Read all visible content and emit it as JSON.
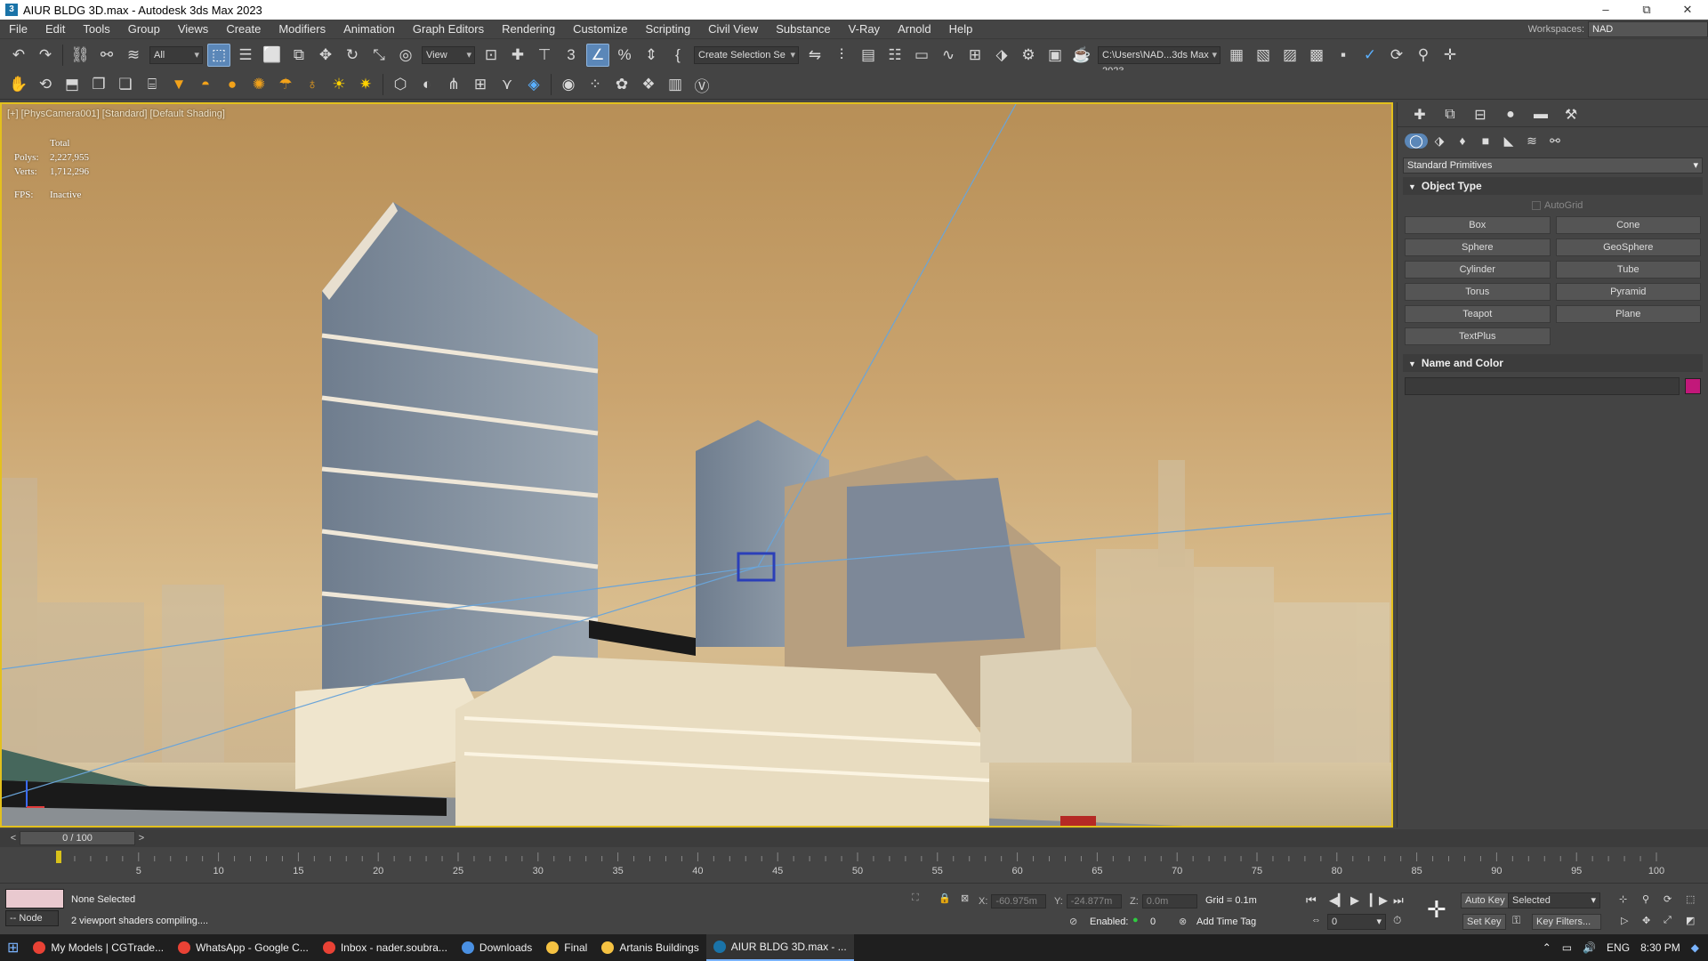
{
  "window": {
    "title": "AIUR BLDG 3D.max - Autodesk 3ds Max 2023",
    "minimize": "–",
    "maximize": "⧉",
    "close": "✕"
  },
  "menubar": {
    "items": [
      "File",
      "Edit",
      "Tools",
      "Group",
      "Views",
      "Create",
      "Modifiers",
      "Animation",
      "Graph Editors",
      "Rendering",
      "Customize",
      "Scripting",
      "Civil View",
      "Substance",
      "V-Ray",
      "Arnold",
      "Help"
    ],
    "workspace_label": "Workspaces:",
    "workspace_value": "NAD"
  },
  "toolbar": {
    "filter_value": "All",
    "refcoord_value": "View",
    "selection_set_placeholder": "Create Selection Se",
    "project_path": "C:\\Users\\NAD...3ds Max 2023"
  },
  "viewport": {
    "label": "[+] [PhysCamera001] [Standard] [Default Shading]",
    "stats_total": "Total",
    "polys_label": "Polys:",
    "polys_value": "2,227,955",
    "verts_label": "Verts:",
    "verts_value": "1,712,296",
    "fps_label": "FPS:",
    "fps_value": "Inactive"
  },
  "command_panel": {
    "category_value": "Standard Primitives",
    "object_type_title": "Object Type",
    "autogrid_label": "AutoGrid",
    "objects": [
      "Box",
      "Cone",
      "Sphere",
      "GeoSphere",
      "Cylinder",
      "Tube",
      "Torus",
      "Pyramid",
      "Teapot",
      "Plane",
      "TextPlus"
    ],
    "name_color_title": "Name and Color",
    "object_color": "#c2187a"
  },
  "timeline": {
    "frame_display": "0 / 100",
    "ticks": [
      "5",
      "10",
      "15",
      "20",
      "25",
      "30",
      "35",
      "40",
      "45",
      "50",
      "55",
      "60",
      "65",
      "70",
      "75",
      "80",
      "85",
      "90",
      "95",
      "100"
    ]
  },
  "status": {
    "selection": "None Selected",
    "prompt": "2 viewport shaders compiling....",
    "node_label": "-- Node",
    "x_label": "X:",
    "x_value": "-60.975m",
    "y_label": "Y:",
    "y_value": "-24.877m",
    "z_label": "Z:",
    "z_value": "0.0m",
    "grid": "Grid = 0.1m",
    "enabled_label": "Enabled:",
    "enabled_value": "0",
    "add_time_tag": "Add Time Tag",
    "auto_key": "Auto Key",
    "set_key": "Set Key",
    "key_mode_value": "Selected",
    "frame_value": "0",
    "key_filters": "Key Filters..."
  },
  "taskbar": {
    "items": [
      {
        "label": "My Models | CGTrade...",
        "color": "#e94235"
      },
      {
        "label": "WhatsApp - Google C...",
        "color": "#e94235"
      },
      {
        "label": "Inbox - nader.soubra...",
        "color": "#e94235"
      },
      {
        "label": "Downloads",
        "color": "#4a90e2"
      },
      {
        "label": "Final",
        "color": "#f5c242"
      },
      {
        "label": "Artanis Buildings",
        "color": "#f5c242"
      },
      {
        "label": "AIUR BLDG 3D.max - ...",
        "color": "#1a73a8"
      }
    ],
    "lang": "ENG",
    "time": "8:30 PM"
  }
}
